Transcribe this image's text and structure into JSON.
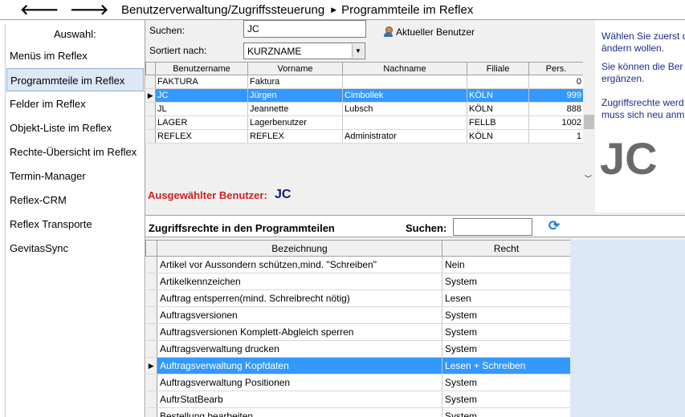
{
  "topbar": {
    "back_glyph": "🡐",
    "forward_glyph": "🡒",
    "breadcrumb": [
      "Benutzerverwaltung/Zugriffssteuerung",
      "Programmteile im Reflex"
    ],
    "separator": "▶"
  },
  "sidebar": {
    "heading": "Auswahl:",
    "items": [
      {
        "label": "Menüs im Reflex",
        "selected": false
      },
      {
        "label": "Programmteile im Reflex",
        "selected": true
      },
      {
        "label": "Felder im Reflex",
        "selected": false
      },
      {
        "label": "Objekt-Liste im Reflex",
        "selected": false
      },
      {
        "label": "Rechte-Übersicht im Reflex",
        "selected": false
      },
      {
        "label": "Termin-Manager",
        "selected": false
      },
      {
        "label": "Reflex-CRM",
        "selected": false
      },
      {
        "label": "Reflex Transporte",
        "selected": false
      },
      {
        "label": "GevitasSync",
        "selected": false
      }
    ]
  },
  "users": {
    "search_label": "Suchen:",
    "search_value": "JC",
    "current_user_label": "Aktueller Benutzer",
    "sort_label": "Sortiert nach:",
    "sort_value": "KURZNAME",
    "columns": [
      "Benutzername",
      "Vorname",
      "Nachname",
      "Filiale",
      "Pers."
    ],
    "rows": [
      {
        "benutzer": "FAKTURA",
        "vorname": "Faktura",
        "nachname": "",
        "filiale": "",
        "pers": "0",
        "selected": false
      },
      {
        "benutzer": "JC",
        "vorname": "Jürgen",
        "nachname": "Cimbollek",
        "filiale": "KÖLN",
        "pers": "999",
        "selected": true
      },
      {
        "benutzer": "JL",
        "vorname": "Jeannette",
        "nachname": "Lubsch",
        "filiale": "KÖLN",
        "pers": "888",
        "selected": false
      },
      {
        "benutzer": "LAGER",
        "vorname": "Lagerbenutzer",
        "nachname": "",
        "filiale": "FELLB",
        "pers": "1002",
        "selected": false
      },
      {
        "benutzer": "REFLEX",
        "vorname": "REFLEX",
        "nachname": "Administrator",
        "filiale": "KÖLN",
        "pers": "1",
        "selected": false
      }
    ],
    "selected_label": "Ausgewählter Benutzer:",
    "selected_value": "JC"
  },
  "info": {
    "line1": "Wählen Sie zuerst d",
    "line2": "ändern wollen.",
    "line3": "Sie können die Ber",
    "line4": "ergänzen.",
    "line5": "Zugriffsrechte werd",
    "line6": "muss sich neu  anm",
    "big_code": "JC"
  },
  "rights": {
    "title": "Zugriffsrechte in den Programmteilen",
    "search_label": "Suchen:",
    "search_value": "",
    "columns": [
      "Bezeichnung",
      "Recht"
    ],
    "rows": [
      {
        "name": "Artikel vor Aussondern schützen,mind. \"Schreiben\"",
        "recht": "Nein",
        "selected": false
      },
      {
        "name": "Artikelkennzeichen",
        "recht": "System",
        "selected": false
      },
      {
        "name": "Auftrag entsperren(mind. Schreibrecht nötig)",
        "recht": "Lesen",
        "selected": false
      },
      {
        "name": "Auftragsversionen",
        "recht": "System",
        "selected": false
      },
      {
        "name": "Auftragsversionen Komplett-Abgleich sperren",
        "recht": "System",
        "selected": false
      },
      {
        "name": "Auftragsverwaltung drucken",
        "recht": "System",
        "selected": false
      },
      {
        "name": "Auftragsverwaltung Kopfdaten",
        "recht": "Lesen + Schreiben",
        "selected": true
      },
      {
        "name": "Auftragsverwaltung Positionen",
        "recht": "System",
        "selected": false
      },
      {
        "name": "AuftrStatBearb",
        "recht": "System",
        "selected": false
      },
      {
        "name": "Bestellung bearbeiten",
        "recht": "System",
        "selected": false
      }
    ]
  },
  "colors": {
    "selection": "#3399ff",
    "selected_user_label": "#d02020",
    "info_text": "#1b2b8f"
  }
}
